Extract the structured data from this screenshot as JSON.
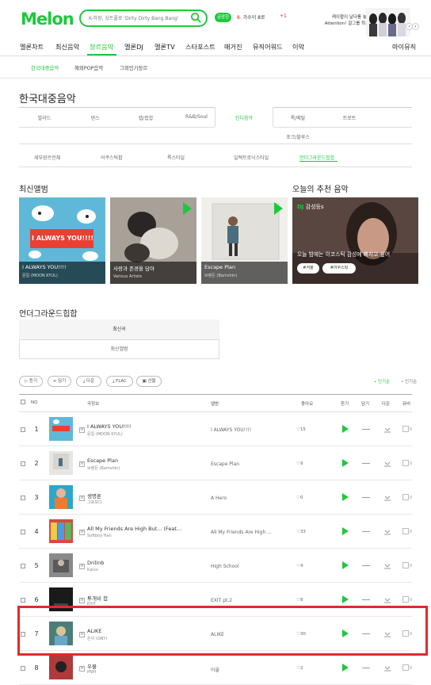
{
  "header": {
    "logo": "Melon",
    "search_value": "K-하장, 싱트풀로 'Dirty Dirty Bang Bang'",
    "lyric_button": "금광한",
    "user_text": "가수이 8로",
    "user_prefix": "8.",
    "plus_badge": "+1",
    "banner_line1": "케이팝이 날다를 놓쳤다서",
    "banner_line2": "Attention! 걸그룹 최초 기록",
    "banner_prev": "‹",
    "banner_next": "›"
  },
  "gnb": {
    "items": [
      "멜론차트",
      "최신음악",
      "장르음악",
      "멜론DJ",
      "멜론TV",
      "스타포스트",
      "매거진",
      "뮤직어워드",
      "이악"
    ],
    "right": "마이뮤직"
  },
  "subnav": {
    "items": [
      "한국대중음악",
      "해외POP음악",
      "그외인기장르"
    ]
  },
  "page": {
    "title": "한국대중음악"
  },
  "genre_tabs": {
    "row1": [
      "발라드",
      "댄스",
      "랩/힙합",
      "R&B/Soul",
      "인디음악",
      "록/메탈",
      "트로트"
    ],
    "row2": [
      "포크/블루스"
    ],
    "sub": [
      "세부장르전체",
      "어쿠스틱팝",
      "록스타일",
      "일렉트로닉스타일",
      "언더그라운드힙합"
    ]
  },
  "sections": {
    "new_albums": "최신앨범",
    "recommended": "오늘의 추천 음악",
    "underground": "언더그라운드힙합"
  },
  "albums": [
    {
      "title": "I ALWAYS YOU!!!!",
      "artist": "문킬 (MOON KYUL)"
    },
    {
      "title": "사랑과 존경을 담아",
      "artist": "Various Artists"
    },
    {
      "title": "Escape Plan",
      "artist": "브랜든 (Barnshin)"
    }
  ],
  "album_cover_text": "I ALWAYS YOU!!!!",
  "reco": {
    "dj_prefix": "DJ",
    "dj_name": "감성등s",
    "text": "오늘 밤에는 이코스틱 감성에 빠지고 싶어",
    "tags": [
      "#겨울",
      "#어쿠스틱"
    ]
  },
  "ug_tabs": [
    "최신곡",
    "최신앨범"
  ],
  "toolbar": {
    "buttons": [
      "듣기",
      "담기",
      "다운",
      "FLAC",
      "선물"
    ],
    "sort_popular": "인기순",
    "sort_other": "인기순"
  },
  "table": {
    "headers": [
      "NO",
      "곡정보",
      "앨범",
      "좋아요",
      "듣기",
      "담기",
      "다운",
      "뮤비"
    ]
  },
  "rows": [
    {
      "rank": "1",
      "title": "I ALWAYS YOU!!!!",
      "artist": "문킬 (MOON KYUL)",
      "album": "I ALWAYS YOU!!!!",
      "likes": "15",
      "mv": "0"
    },
    {
      "rank": "2",
      "title": "Escape Plan",
      "artist": "브랜든 (Barnshin)",
      "album": "Escape Plan",
      "likes": "9",
      "mv": "0"
    },
    {
      "rank": "3",
      "title": "생명론",
      "artist": "그로보디",
      "album": "A Hero",
      "likes": "0",
      "mv": "0"
    },
    {
      "rank": "4",
      "title": "All My Friends Are High But... (Feat...",
      "artist": "Softboy Han",
      "album": "All My Friends Are High ...",
      "likes": "33",
      "mv": "0"
    },
    {
      "rank": "5",
      "title": "Drilinb",
      "artist": "Kaluv",
      "album": "High School",
      "likes": "4",
      "mv": "0"
    },
    {
      "rank": "6",
      "title": "투개비 첩",
      "artist": "EXIT",
      "album": "EXIT pt.2",
      "likes": "8",
      "mv": "0"
    },
    {
      "rank": "7",
      "title": "ALIKE",
      "artist": "온이 (ONY)",
      "album": "ALIKE",
      "likes": "30",
      "mv": "0"
    },
    {
      "rank": "8",
      "title": "우물",
      "artist": "PNPI",
      "album": "아울",
      "likes": "2",
      "mv": "0"
    }
  ],
  "colors": {
    "brand": "#1dc93c",
    "highlight": "#e02a2a"
  }
}
